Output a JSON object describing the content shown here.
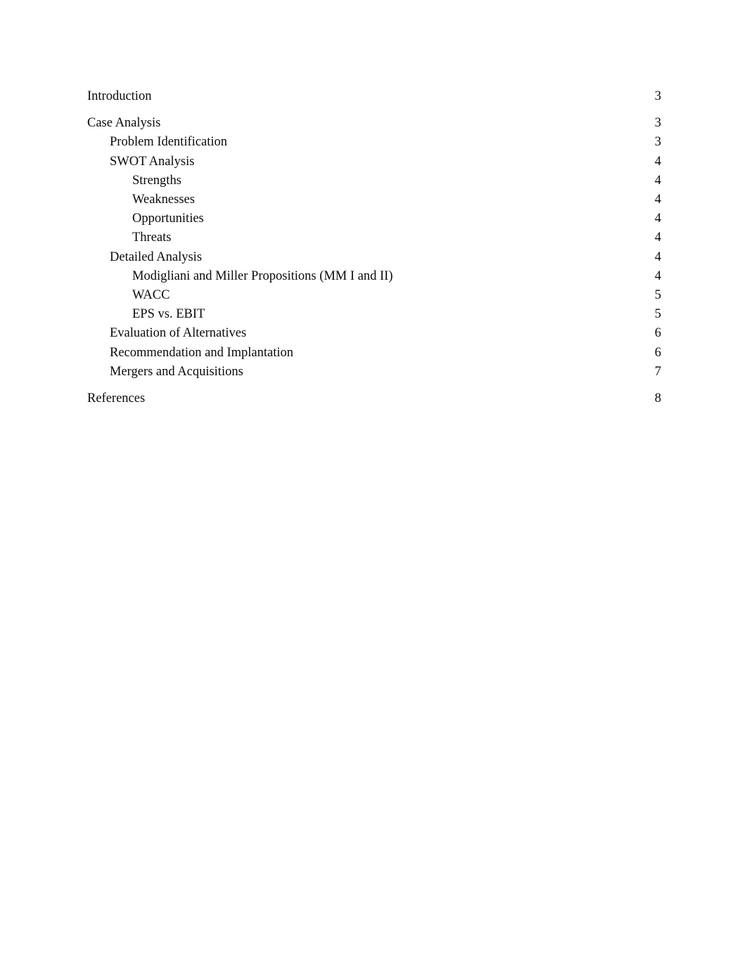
{
  "document": {
    "type": "table-of-contents",
    "entries": [
      {
        "label": "Introduction",
        "page": "3",
        "level": 1,
        "gap_before": false
      },
      {
        "label": "Case Analysis",
        "page": "3",
        "level": 1,
        "gap_before": true
      },
      {
        "label": "Problem Identification",
        "page": "3",
        "level": 2,
        "gap_before": false
      },
      {
        "label": "SWOT Analysis",
        "page": "4",
        "level": 2,
        "gap_before": false
      },
      {
        "label": "Strengths",
        "page": "4",
        "level": 3,
        "gap_before": false
      },
      {
        "label": "Weaknesses",
        "page": "4",
        "level": 3,
        "gap_before": false
      },
      {
        "label": "Opportunities",
        "page": "4",
        "level": 3,
        "gap_before": false
      },
      {
        "label": "Threats",
        "page": "4",
        "level": 3,
        "gap_before": false
      },
      {
        "label": "Detailed Analysis",
        "page": "4",
        "level": 2,
        "gap_before": false
      },
      {
        "label": "Modigliani and Miller Propositions (MM I and II)",
        "page": "4",
        "level": 3,
        "gap_before": false
      },
      {
        "label": "WACC",
        "page": "5",
        "level": 3,
        "gap_before": false
      },
      {
        "label": "EPS vs. EBIT",
        "page": "5",
        "level": 3,
        "gap_before": false
      },
      {
        "label": "Evaluation of Alternatives",
        "page": "6",
        "level": 2,
        "gap_before": false
      },
      {
        "label": "Recommendation and Implantation",
        "page": "6",
        "level": 2,
        "gap_before": false
      },
      {
        "label": "Mergers and Acquisitions",
        "page": "7",
        "level": 2,
        "gap_before": false
      },
      {
        "label": "References",
        "page": "8",
        "level": 1,
        "gap_before": true
      }
    ]
  }
}
